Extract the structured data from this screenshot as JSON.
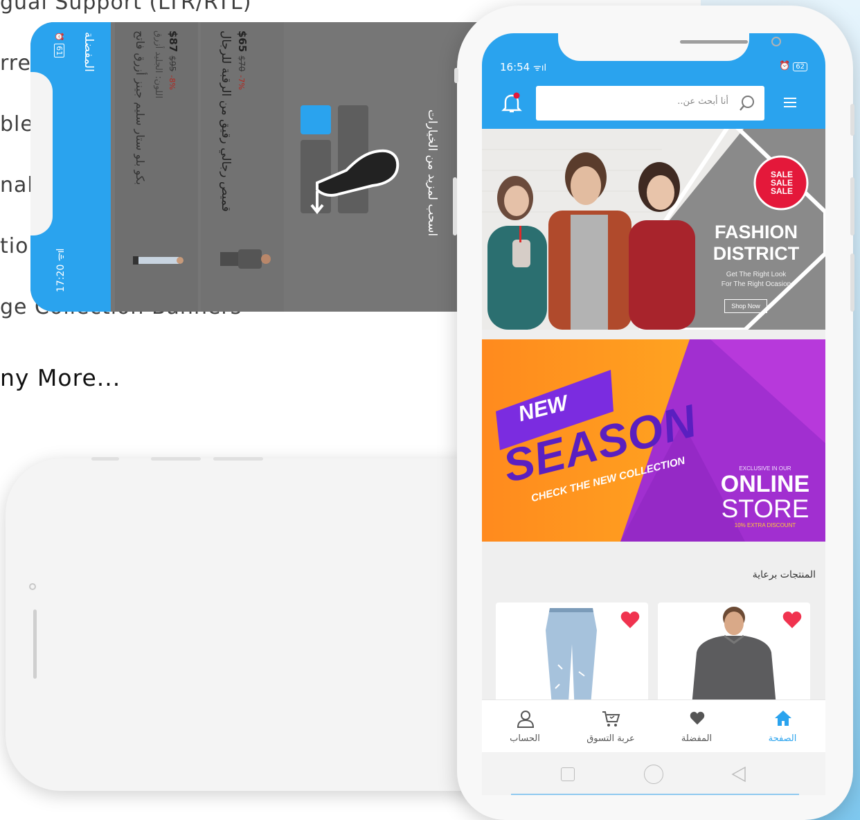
{
  "features": [
    {
      "label": "gual Support (LTR/RTL)"
    },
    {
      "label": "rrency"
    },
    {
      "label": "ble App Labels"
    },
    {
      "label": "nal Overlays"
    },
    {
      "label": "tions"
    },
    {
      "label": "ge Collection Banners"
    }
  ],
  "more_label": "ny More...",
  "landscape": {
    "time": "17:20",
    "battery": "61",
    "title": "المفضلة",
    "products": [
      {
        "name": "بكو بلو ستار سليم جينز أزرق فاتح",
        "color": "اللون: الجليد أزرق",
        "price": "$87",
        "old_price": "$95",
        "discount": "-8%"
      },
      {
        "name": "قميص رجالي رقيق من الرقبة للرجال",
        "price": "$65",
        "old_price": "$70",
        "discount": "-7%"
      }
    ],
    "swipe_hint": "اسحب لمزيد من الخيارات"
  },
  "portrait": {
    "time": "16:54",
    "battery": "62",
    "search_placeholder": "أنا أبحث عن..",
    "banner1": {
      "badge": [
        "SALE",
        "SALE",
        "SALE"
      ],
      "title1": "FASHION",
      "title2": "DISTRICT",
      "sub1": "Get The Right Look",
      "sub2": "For The Right Ocasion",
      "cta": "Shop Now"
    },
    "banner2": {
      "new": "NEW",
      "season": "SEASON",
      "check": "CHECK THE NEW COLLECTION",
      "exclusive": "EXCLUSIVE IN OUR",
      "online": "ONLINE",
      "store": "STORE",
      "discount": "10% EXTRA DISCOUNT"
    },
    "section_title": "المنتجات برعاية",
    "nav": [
      {
        "label": "الحساب",
        "icon": "user-icon"
      },
      {
        "label": "عربة التسوق",
        "icon": "cart-icon"
      },
      {
        "label": "المفضلة",
        "icon": "heart-icon"
      },
      {
        "label": "الصفحة",
        "icon": "home-icon"
      }
    ]
  },
  "colors": {
    "primary": "#2aa3ee",
    "heart": "#f0334f",
    "sale": "#e4183a"
  }
}
